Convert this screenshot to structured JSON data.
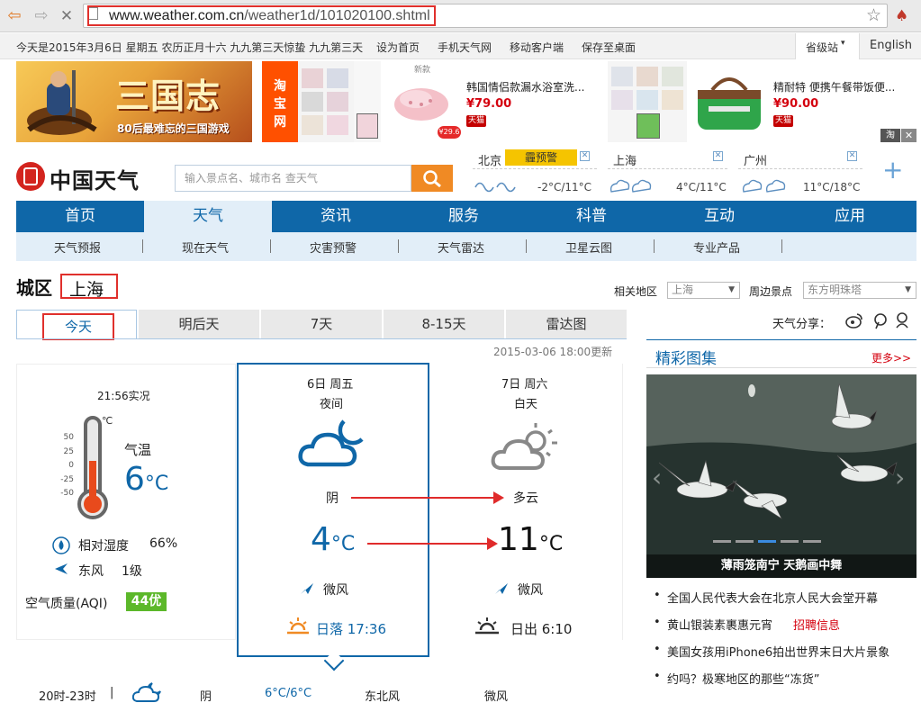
{
  "browser": {
    "url_host": "www.weather.com.cn",
    "url_path": "/weather1d/101020100.shtml"
  },
  "topbar": {
    "date": "今天是2015年3月6日 星期五 农历正月十六 九九第三天惊蛰 九九第三天",
    "links": [
      "设为首页",
      "手机天气网",
      "移动客户端",
      "保存至桌面"
    ],
    "province_label": "省级站",
    "english_label": "English"
  },
  "ads": {
    "game_title": "三国志",
    "game_sub": "80后最难忘的三国游戏",
    "taobao_label": "淘宝网",
    "item1_title": "韩国情侣款漏水浴室洗...",
    "item1_price": "¥79.00",
    "item1_store": "天猫",
    "item2_title": "精耐特 便携午餐带饭便...",
    "item2_price": "¥90.00",
    "item2_store": "天猫",
    "corner_label": "淘"
  },
  "header": {
    "logo_text": "中国天气",
    "search_placeholder": "输入景点名、城市名 查天气",
    "cities": [
      {
        "name": "北京",
        "alert": "霾预警",
        "temp": "-2°C/11°C"
      },
      {
        "name": "上海",
        "temp": "4°C/11°C"
      },
      {
        "name": "广州",
        "temp": "11°C/18°C"
      }
    ],
    "plus": "+"
  },
  "nav": {
    "main": [
      "首页",
      "天气",
      "资讯",
      "服务",
      "科普",
      "互动",
      "应用"
    ],
    "sub": [
      "天气预报",
      "现在天气",
      "灾害预警",
      "天气雷达",
      "卫星云图",
      "专业产品"
    ]
  },
  "section": {
    "district": "城区",
    "city": "上海",
    "related_label": "相关地区",
    "related_value": "上海",
    "nearby_label": "周边景点",
    "nearby_value": "东方明珠塔",
    "tabs": [
      "今天",
      "明后天",
      "7天",
      "8-15天",
      "雷达图"
    ],
    "share_label": "天气分享：",
    "updated": "2015-03-06 18:00更新"
  },
  "current": {
    "time": "21:56实况",
    "unit": "℃",
    "scale": [
      "50",
      "25",
      "0",
      "-25",
      "-50"
    ],
    "temp_label": "气温",
    "temp": "6",
    "temp_unit": "°C",
    "humidity_label": "相对湿度",
    "humidity": "66%",
    "wind_dir": "东风",
    "wind_level": "1级",
    "aqi_label": "空气质量(AQI)",
    "aqi": "44优"
  },
  "tonight": {
    "date": "6日 周五",
    "period": "夜间",
    "weather": "阴",
    "temp": "4",
    "temp_unit": "°C",
    "wind": "微风",
    "sun_label": "日落 17:36"
  },
  "tomorrow": {
    "date": "7日 周六",
    "period": "白天",
    "weather": "多云",
    "temp": "11",
    "temp_unit": "°C",
    "wind": "微风",
    "sun_label": "日出 6:10"
  },
  "hourly": {
    "time": "20时-23时",
    "sep": "|",
    "weather": "阴",
    "temp": "6°C/6°C",
    "wind_dir": "东北风",
    "wind": "微风"
  },
  "gallery": {
    "title": "精彩图集",
    "more": "更多>>",
    "caption": "薄雨笼南宁 天鹅画中舞",
    "news": [
      "全国人民代表大会在北京人民大会堂开幕",
      "黄山银装素裹惠元宵",
      "美国女孩用iPhone6拍出世界末日大片景象",
      "约吗？极寒地区的那些“冻货”"
    ],
    "recruit": "招聘信息"
  },
  "colors": {
    "brand_blue": "#0f67a8",
    "light_blue": "#e2eef8",
    "highlight_red": "#e0302c",
    "aqi_green": "#5cb82a",
    "alert_yellow": "#f5c400"
  }
}
